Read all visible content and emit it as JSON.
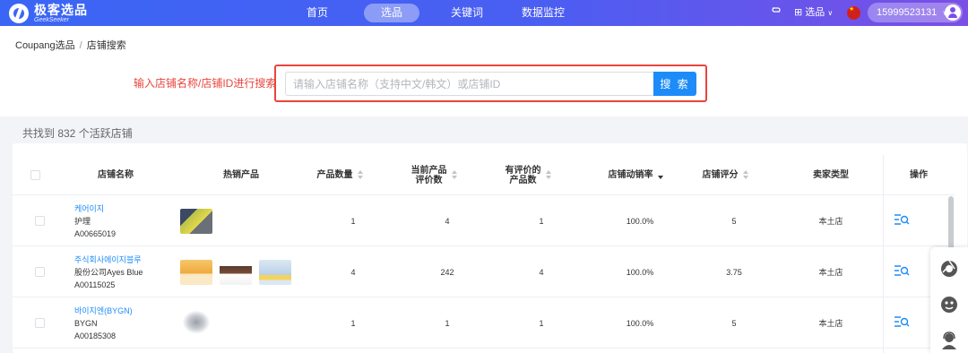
{
  "brand": {
    "name_cn": "极客选品",
    "name_en": "GeekSeeker"
  },
  "nav": {
    "items": [
      {
        "label": "首页",
        "active": false
      },
      {
        "label": "选品",
        "active": true
      },
      {
        "label": "关键词",
        "active": false
      },
      {
        "label": "数据监控",
        "active": false
      }
    ]
  },
  "header_tools": {
    "module_label": "选品",
    "phone": "15999523131"
  },
  "breadcrumb": {
    "root": "Coupang选品",
    "separator": "/",
    "current": "店铺搜索"
  },
  "search": {
    "label": "输入店铺名称/店铺ID进行搜索",
    "placeholder": "请输入店铺名称（支持中文/韩文）或店铺ID",
    "value": "",
    "button": "搜 索"
  },
  "result_summary": "共找到 832 个活跃店铺",
  "table": {
    "headers": {
      "name": "店铺名称",
      "hot": "热销产品",
      "count": "产品数量",
      "rated_line1": "当前产品",
      "rated_line2": "评价数",
      "with_review_line1": "有评价的",
      "with_review_line2": "产品数",
      "sell_rate": "店铺动销率",
      "score": "店铺评分",
      "seller_type": "卖家类型",
      "op": "操作"
    },
    "rows": [
      {
        "name": "케어이지",
        "category": "护理",
        "id": "A00665019",
        "product_count": "1",
        "review_count": "4",
        "reviewed_products": "1",
        "sell_rate": "100.0%",
        "score": "5",
        "seller_type": "本土店"
      },
      {
        "name": "주식회사에이지블루",
        "category": "股份公司Ayes Blue",
        "id": "A00115025",
        "product_count": "4",
        "review_count": "242",
        "reviewed_products": "4",
        "sell_rate": "100.0%",
        "score": "3.75",
        "seller_type": "本土店"
      },
      {
        "name": "바이지엔(BYGN)",
        "category": "BYGN",
        "id": "A00185308",
        "product_count": "1",
        "review_count": "1",
        "reviewed_products": "1",
        "sell_rate": "100.0%",
        "score": "5",
        "seller_type": "本土店"
      }
    ]
  },
  "colors": {
    "accent": "#1d8cf8",
    "highlight_red": "#e8453c",
    "nav_start": "#3a66f5",
    "nav_end": "#7b4fe6"
  }
}
